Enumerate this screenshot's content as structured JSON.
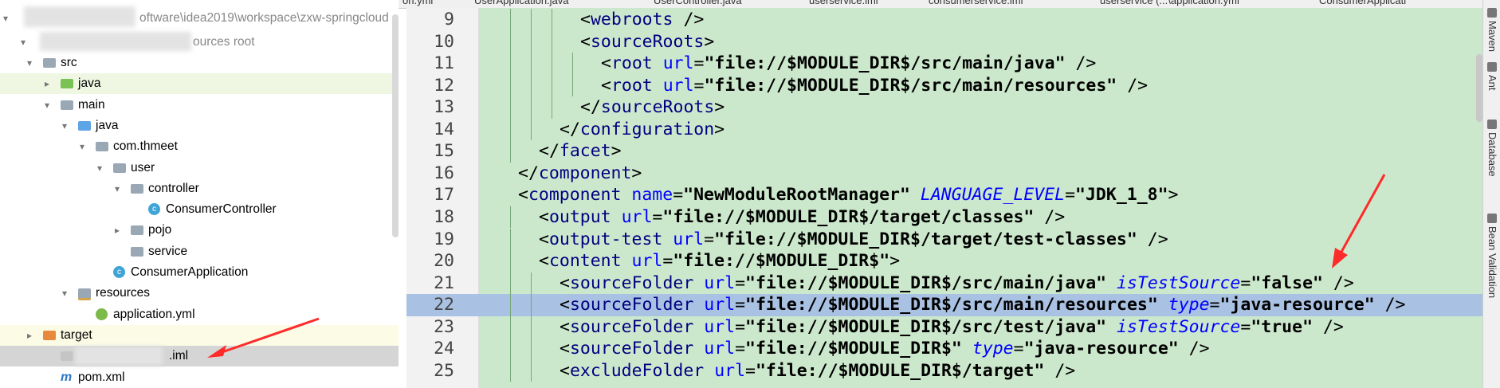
{
  "project_tree": {
    "header_path": "oftware\\idea2019\\workspace\\zxw-springcloud",
    "module_suffix": "ources root",
    "items": [
      {
        "label": "src",
        "depth": 2,
        "arrow": "down",
        "icon": "folder-icon"
      },
      {
        "label": "java",
        "depth": 3,
        "arrow": "right",
        "icon": "test-folder-icon",
        "highlight": "green"
      },
      {
        "label": "main",
        "depth": 3,
        "arrow": "down",
        "icon": "folder-icon"
      },
      {
        "label": "java",
        "depth": 4,
        "arrow": "down",
        "icon": "source-folder-icon"
      },
      {
        "label": "com.thmeet",
        "depth": 5,
        "arrow": "down",
        "icon": "package-icon"
      },
      {
        "label": "user",
        "depth": 6,
        "arrow": "down",
        "icon": "package-icon"
      },
      {
        "label": "controller",
        "depth": 7,
        "arrow": "down",
        "icon": "package-icon"
      },
      {
        "label": "ConsumerController",
        "depth": 8,
        "arrow": "",
        "icon": "class-icon"
      },
      {
        "label": "pojo",
        "depth": 7,
        "arrow": "right",
        "icon": "package-icon"
      },
      {
        "label": "service",
        "depth": 7,
        "arrow": "",
        "icon": "package-icon"
      },
      {
        "label": "ConsumerApplication",
        "depth": 6,
        "arrow": "",
        "icon": "spring-class-icon"
      },
      {
        "label": "resources",
        "depth": 4,
        "arrow": "down",
        "icon": "resources-folder-icon"
      },
      {
        "label": "application.yml",
        "depth": 5,
        "arrow": "",
        "icon": "yml-icon"
      },
      {
        "label": "target",
        "depth": 2,
        "arrow": "right",
        "icon": "excluded-folder-icon",
        "highlight": "yellow"
      },
      {
        "label": ".iml",
        "depth": 3,
        "arrow": "",
        "icon": "iml-icon",
        "highlight": "gray"
      },
      {
        "label": "pom.xml",
        "depth": 3,
        "arrow": "",
        "icon": "maven-icon"
      }
    ]
  },
  "tabs": [
    {
      "label": "on.yml",
      "active": false
    },
    {
      "label": "UserApplication.java",
      "active": false
    },
    {
      "label": "UserController.java",
      "active": false
    },
    {
      "label": "userservice.iml",
      "active": false
    },
    {
      "label": "consumerservice.iml",
      "active": true
    },
    {
      "label": "userservice (...\\application.yml",
      "active": false
    },
    {
      "label": "ConsumerApplicati",
      "active": false
    }
  ],
  "editor": {
    "lines": [
      {
        "n": "9",
        "indent": 4,
        "tokens": [
          [
            "br",
            "<"
          ],
          [
            "tag",
            "webroots"
          ],
          [
            "br",
            " />"
          ]
        ]
      },
      {
        "n": "10",
        "indent": 4,
        "tokens": [
          [
            "br",
            "<"
          ],
          [
            "tag",
            "sourceRoots"
          ],
          [
            "br",
            ">"
          ]
        ]
      },
      {
        "n": "11",
        "indent": 5,
        "tokens": [
          [
            "br",
            "<"
          ],
          [
            "tag",
            "root"
          ],
          [
            "br",
            " "
          ],
          [
            "attr",
            "url"
          ],
          [
            "br",
            "="
          ],
          [
            "val",
            "\"file://$MODULE_DIR$/src/main/java\""
          ],
          [
            "br",
            " />"
          ]
        ]
      },
      {
        "n": "12",
        "indent": 5,
        "tokens": [
          [
            "br",
            "<"
          ],
          [
            "tag",
            "root"
          ],
          [
            "br",
            " "
          ],
          [
            "attr",
            "url"
          ],
          [
            "br",
            "="
          ],
          [
            "val",
            "\"file://$MODULE_DIR$/src/main/resources\""
          ],
          [
            "br",
            " />"
          ]
        ]
      },
      {
        "n": "13",
        "indent": 4,
        "tokens": [
          [
            "br",
            "</"
          ],
          [
            "tag",
            "sourceRoots"
          ],
          [
            "br",
            ">"
          ]
        ]
      },
      {
        "n": "14",
        "indent": 3,
        "tokens": [
          [
            "br",
            "</"
          ],
          [
            "tag",
            "configuration"
          ],
          [
            "br",
            ">"
          ]
        ]
      },
      {
        "n": "15",
        "indent": 2,
        "tokens": [
          [
            "br",
            "</"
          ],
          [
            "tag",
            "facet"
          ],
          [
            "br",
            ">"
          ]
        ]
      },
      {
        "n": "16",
        "indent": 1,
        "tokens": [
          [
            "br",
            "</"
          ],
          [
            "tag",
            "component"
          ],
          [
            "br",
            ">"
          ]
        ]
      },
      {
        "n": "17",
        "indent": 1,
        "tokens": [
          [
            "br",
            "<"
          ],
          [
            "tag",
            "component"
          ],
          [
            "br",
            " "
          ],
          [
            "attr",
            "name"
          ],
          [
            "br",
            "="
          ],
          [
            "val",
            "\"NewModuleRootManager\""
          ],
          [
            "br",
            " "
          ],
          [
            "attrit",
            "LANGUAGE_LEVEL"
          ],
          [
            "br",
            "="
          ],
          [
            "val",
            "\"JDK_1_8\""
          ],
          [
            "br",
            ">"
          ]
        ]
      },
      {
        "n": "18",
        "indent": 2,
        "tokens": [
          [
            "br",
            "<"
          ],
          [
            "tag",
            "output"
          ],
          [
            "br",
            " "
          ],
          [
            "attr",
            "url"
          ],
          [
            "br",
            "="
          ],
          [
            "val",
            "\"file://$MODULE_DIR$/target/classes\""
          ],
          [
            "br",
            " />"
          ]
        ]
      },
      {
        "n": "19",
        "indent": 2,
        "tokens": [
          [
            "br",
            "<"
          ],
          [
            "tag",
            "output-test"
          ],
          [
            "br",
            " "
          ],
          [
            "attr",
            "url"
          ],
          [
            "br",
            "="
          ],
          [
            "val",
            "\"file://$MODULE_DIR$/target/test-classes\""
          ],
          [
            "br",
            " />"
          ]
        ]
      },
      {
        "n": "20",
        "indent": 2,
        "tokens": [
          [
            "br",
            "<"
          ],
          [
            "tag",
            "content"
          ],
          [
            "br",
            " "
          ],
          [
            "attr",
            "url"
          ],
          [
            "br",
            "="
          ],
          [
            "val",
            "\"file://$MODULE_DIR$\""
          ],
          [
            "br",
            ">"
          ]
        ]
      },
      {
        "n": "21",
        "indent": 3,
        "tokens": [
          [
            "br",
            "<"
          ],
          [
            "tag",
            "sourceFolder"
          ],
          [
            "br",
            " "
          ],
          [
            "attr",
            "url"
          ],
          [
            "br",
            "="
          ],
          [
            "val",
            "\"file://$MODULE_DIR$/src/main/java\""
          ],
          [
            "br",
            " "
          ],
          [
            "attrit",
            "isTestSource"
          ],
          [
            "br",
            "="
          ],
          [
            "val",
            "\"false\""
          ],
          [
            "br",
            " />"
          ]
        ]
      },
      {
        "n": "22",
        "indent": 3,
        "selected": true,
        "tokens": [
          [
            "br",
            "<"
          ],
          [
            "tag",
            "sourceFolder"
          ],
          [
            "br",
            " "
          ],
          [
            "attr",
            "url"
          ],
          [
            "br",
            "="
          ],
          [
            "val",
            "\"file://$MODULE_DIR$/src/main/resources\""
          ],
          [
            "br",
            " "
          ],
          [
            "attrit",
            "type"
          ],
          [
            "br",
            "="
          ],
          [
            "val",
            "\"java-resource\""
          ],
          [
            "br",
            " />"
          ]
        ]
      },
      {
        "n": "23",
        "indent": 3,
        "tokens": [
          [
            "br",
            "<"
          ],
          [
            "tag",
            "sourceFolder"
          ],
          [
            "br",
            " "
          ],
          [
            "attr",
            "url"
          ],
          [
            "br",
            "="
          ],
          [
            "val",
            "\"file://$MODULE_DIR$/src/test/java\""
          ],
          [
            "br",
            " "
          ],
          [
            "attrit",
            "isTestSource"
          ],
          [
            "br",
            "="
          ],
          [
            "val",
            "\"true\""
          ],
          [
            "br",
            " />"
          ]
        ]
      },
      {
        "n": "24",
        "indent": 3,
        "tokens": [
          [
            "br",
            "<"
          ],
          [
            "tag",
            "sourceFolder"
          ],
          [
            "br",
            " "
          ],
          [
            "attr",
            "url"
          ],
          [
            "br",
            "="
          ],
          [
            "val",
            "\"file://$MODULE_DIR$\""
          ],
          [
            "br",
            " "
          ],
          [
            "attrit",
            "type"
          ],
          [
            "br",
            "="
          ],
          [
            "val",
            "\"java-resource\""
          ],
          [
            "br",
            " />"
          ]
        ]
      },
      {
        "n": "25",
        "indent": 3,
        "tokens": [
          [
            "br",
            "<"
          ],
          [
            "tag",
            "excludeFolder"
          ],
          [
            "br",
            " "
          ],
          [
            "attr",
            "url"
          ],
          [
            "br",
            "="
          ],
          [
            "val",
            "\"file://$MODULE_DIR$/target\""
          ],
          [
            "br",
            " />"
          ]
        ]
      }
    ]
  },
  "right_tool_windows": [
    {
      "label": "Maven",
      "icon": "maven-icon"
    },
    {
      "label": "Ant",
      "icon": "ant-icon"
    },
    {
      "label": "Database",
      "icon": "database-icon"
    },
    {
      "label": "Bean Validation",
      "icon": "bean-validation-icon"
    }
  ],
  "colors": {
    "editor_bg": "#cce8cc",
    "selected_line": "#a9c1e2",
    "tag": "#000080",
    "attr": "#0000ff",
    "annotation_arrow": "#ff2a2a"
  }
}
